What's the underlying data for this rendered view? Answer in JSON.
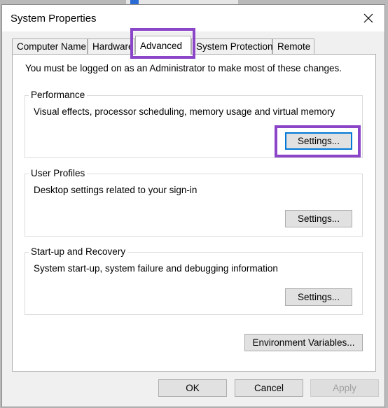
{
  "window": {
    "title": "System Properties"
  },
  "tabs": [
    {
      "label": "Computer Name",
      "active": false
    },
    {
      "label": "Hardware",
      "active": false
    },
    {
      "label": "Advanced",
      "active": true
    },
    {
      "label": "System Protection",
      "active": false
    },
    {
      "label": "Remote",
      "active": false
    }
  ],
  "advanced": {
    "notice": "You must be logged on as an Administrator to make most of these changes.",
    "performance": {
      "title": "Performance",
      "description": "Visual effects, processor scheduling, memory usage and virtual memory",
      "button": "Settings..."
    },
    "user_profiles": {
      "title": "User Profiles",
      "description": "Desktop settings related to your sign-in",
      "button": "Settings..."
    },
    "startup_recovery": {
      "title": "Start-up and Recovery",
      "description": "System start-up, system failure and debugging information",
      "button": "Settings..."
    },
    "environment_button": "Environment Variables..."
  },
  "footer": {
    "ok": "OK",
    "cancel": "Cancel",
    "apply": "Apply"
  },
  "colors": {
    "highlight": "#8b45c8",
    "default_button_border": "#0078d7"
  }
}
